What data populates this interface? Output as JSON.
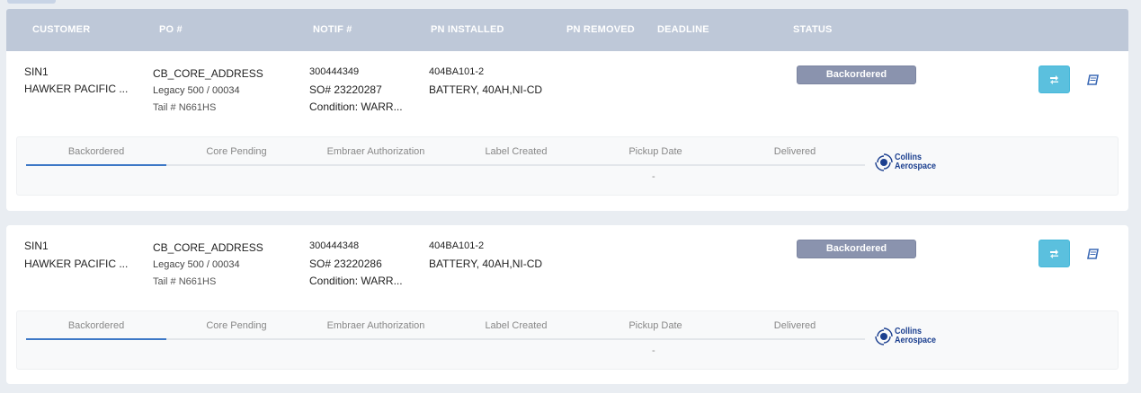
{
  "header": {
    "columns": [
      "CUSTOMER",
      "PO #",
      "NOTIF #",
      "PN INSTALLED",
      "PN REMOVED",
      "DEADLINE",
      "STATUS"
    ]
  },
  "orders": [
    {
      "customer_code": "SIN1",
      "customer_name": "HAWKER PACIFIC ...",
      "po": "CB_CORE_ADDRESS",
      "legacy": "Legacy 500 / 00034",
      "tail": "Tail # N661HS",
      "notif": "300444349",
      "so": "SO# 23220287",
      "condition": "Condition: WARR...",
      "pn_installed": "404BA101-2",
      "pn_description": "BATTERY, 40AH,NI-CD",
      "status": "Backordered",
      "tracker": {
        "steps": [
          "Backordered",
          "Core Pending",
          "Embraer Authorization",
          "Label Created",
          "Pickup Date",
          "Delivered"
        ],
        "active_step": "Backordered",
        "pickup_value": "-",
        "logo_line1": "Collins",
        "logo_line2": "Aerospace"
      }
    },
    {
      "customer_code": "SIN1",
      "customer_name": "HAWKER PACIFIC ...",
      "po": "CB_CORE_ADDRESS",
      "legacy": "Legacy 500 / 00034",
      "tail": "Tail # N661HS",
      "notif": "300444348",
      "so": "SO# 23220286",
      "condition": "Condition: WARR...",
      "pn_installed": "404BA101-2",
      "pn_description": "BATTERY, 40AH,NI-CD",
      "status": "Backordered",
      "tracker": {
        "steps": [
          "Backordered",
          "Core Pending",
          "Embraer Authorization",
          "Label Created",
          "Pickup Date",
          "Delivered"
        ],
        "active_step": "Backordered",
        "pickup_value": "-",
        "logo_line1": "Collins",
        "logo_line2": "Aerospace"
      }
    }
  ],
  "icons": {
    "refresh": "refresh-icon",
    "book": "book-icon",
    "logo": "collins-aerospace-logo-icon"
  },
  "colors": {
    "header_bg": "#bec8d8",
    "status_badge": "#8a93ae",
    "refresh_button": "#5bc0de",
    "active_step": "#3d78c6",
    "logo": "#1b3f8f"
  }
}
